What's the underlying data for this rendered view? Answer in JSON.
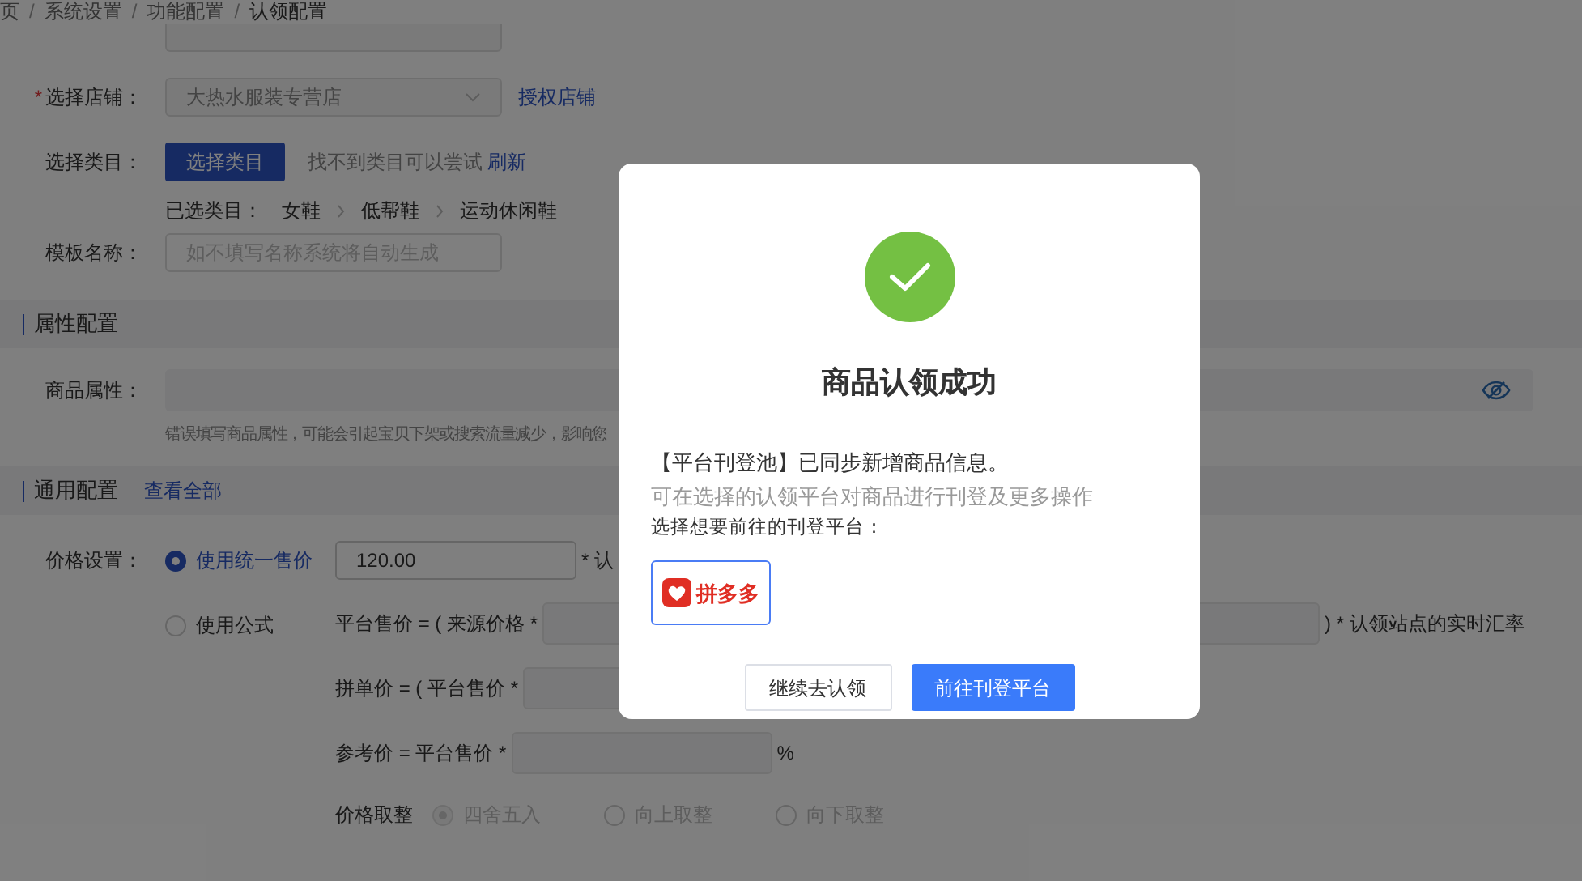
{
  "breadcrumb": [
    {
      "kind": "item",
      "text": "页"
    },
    {
      "kind": "separator",
      "text": "/"
    },
    {
      "kind": "item",
      "text": "系统设置"
    },
    {
      "kind": "separator",
      "text": "/"
    },
    {
      "kind": "item",
      "text": "功能配置"
    },
    {
      "kind": "separator",
      "text": "/"
    },
    {
      "kind": "item",
      "text": "认领配置"
    }
  ],
  "form": {
    "store": {
      "label": "选择店铺：",
      "required_mark": "*",
      "value": "大热水服装专营店",
      "link": "授权店铺"
    },
    "category": {
      "label": "选择类目：",
      "button": "选择类目",
      "hint": "找不到类目可以尝试",
      "link": "刷新",
      "selected_label": "已选类目：",
      "path": [
        "女鞋",
        "低帮鞋",
        "运动休闲鞋"
      ]
    },
    "template_name": {
      "label": "模板名称：",
      "placeholder": "如不填写名称系统将自动生成"
    }
  },
  "attribute_section": {
    "title": "属性配置",
    "label": "商品属性：",
    "hint": "错误填写商品属性，可能会引起宝贝下架或搜索流量减少，影响您"
  },
  "general_section": {
    "title": "通用配置",
    "link": "查看全部",
    "price_label": "价格设置：",
    "price_options": [
      {
        "label": "使用统一售价",
        "selected": true
      },
      {
        "label": "使用公式",
        "selected": false
      }
    ],
    "unified_price": "120.00",
    "unified_suffix": "* 认",
    "formulas": [
      {
        "label": "平台售价 = ( 来源价格 *",
        "suffix": ") * 认领站点的实时汇率"
      },
      {
        "label": "拼单价 = ( 平台售价 *"
      },
      {
        "label": "参考价 = 平台售价 *",
        "suffix": "%"
      }
    ],
    "rounding_label": "价格取整",
    "rounding_options": [
      {
        "label": "四舍五入",
        "selected": true
      },
      {
        "label": "向上取整",
        "selected": false
      },
      {
        "label": "向下取整",
        "selected": false
      }
    ]
  },
  "dialog": {
    "title": "商品认领成功",
    "message": "【平台刊登池】已同步新增商品信息。",
    "note": "可在选择的认领平台对商品进行刊登及更多操作",
    "prompt": "选择想要前往的刊登平台：",
    "platforms": [
      {
        "name": "拼多多",
        "selected": true
      }
    ],
    "buttons": [
      {
        "label": "继续去认领",
        "kind": "secondary"
      },
      {
        "label": "前往刊登平台",
        "kind": "primary"
      }
    ]
  }
}
